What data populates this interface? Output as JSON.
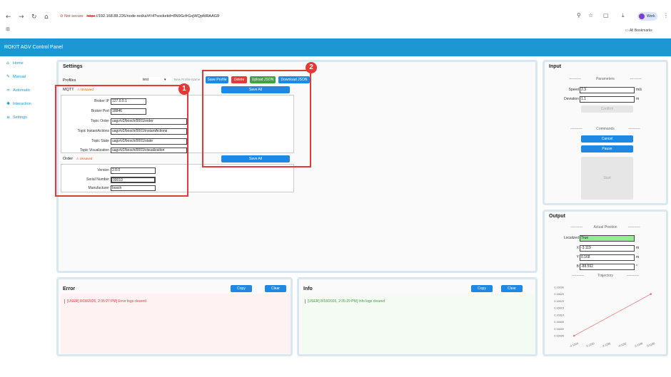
{
  "browser": {
    "not_secure": "Not secure",
    "url_proto": "https",
    "url_rest": "://192.168.88.226/node-red/ui/#!/4?socketid=8N9GcfrGxjWQpfdRAAG9",
    "profile": "Work",
    "all_bookmarks": "All Bookmarks"
  },
  "app": {
    "title": "ROKIT AGV Control Panel"
  },
  "sidebar": {
    "items": [
      {
        "label": "Home",
        "icon": "home-icon"
      },
      {
        "label": "Manual",
        "icon": "wrench-icon"
      },
      {
        "label": "Automatic",
        "icon": "infinity-icon"
      },
      {
        "label": "Interaction",
        "icon": "puzzle-icon"
      },
      {
        "label": "Settings",
        "icon": "sliders-icon"
      }
    ]
  },
  "settings": {
    "title": "Settings",
    "profiles_label": "Profiles",
    "profile_selected": "test",
    "new_profile_placeholder": "New Profile Name",
    "save_profile": "Save Profile",
    "delete": "Delete",
    "upload_json": "Upload JSON",
    "download_json": "Download JSON",
    "save_all": "Save All",
    "unsaved": "Unsaved",
    "mqtt": {
      "legend": "MQTT",
      "fields": [
        {
          "label": "Broker IP",
          "value": "127.0.0.1"
        },
        {
          "label": "Broker Port",
          "value": "18846"
        },
        {
          "label": "Topic Order",
          "value": "uagv/v2/bosch/0001/order"
        },
        {
          "label": "Topic InstantActions",
          "value": "uagv/v2/bosch/0001/instantActions"
        },
        {
          "label": "Topic State",
          "value": "uagv/v2/bosch/0001/state"
        },
        {
          "label": "Topic Visualization",
          "value": "uagv/v2/bosch/0001/visualization"
        }
      ]
    },
    "order": {
      "legend": "Order",
      "fields": [
        {
          "label": "Version",
          "value": "2.0.0"
        },
        {
          "label": "Serial Number",
          "value": "00010"
        },
        {
          "label": "Manufacturer",
          "value": "bosch"
        }
      ]
    }
  },
  "annotations": {
    "one": "1",
    "two": "2"
  },
  "input": {
    "title": "Input",
    "parameters_label": "Parameters",
    "speed_label": "Speed",
    "speed_value": "2.3",
    "speed_unit": "m/s",
    "deviation_label": "Deviation",
    "deviation_value": "1.1",
    "deviation_unit": "m",
    "confirm": "Confirm",
    "commands_label": "Commands",
    "cancel": "Cancel",
    "pause": "Pause",
    "start": "Start"
  },
  "output": {
    "title": "Output",
    "actual_position_label": "Actual Position",
    "localized_label": "Localized",
    "localized_value": "True",
    "x_label": "X",
    "x_value": "-3.119",
    "x_unit": "m",
    "y_label": "Y",
    "y_value": "0.168",
    "y_unit": "m",
    "b_label": "B",
    "b_value": "-88.592",
    "b_unit": "°",
    "trajectory_label": "Trajectory",
    "dashes": "----------"
  },
  "error": {
    "title": "Error",
    "copy": "Copy",
    "clear": "Clear",
    "log": "[USER] 8/18/2026, 2:35:27 PM] Error logs cleared"
  },
  "info": {
    "title": "Info",
    "copy": "Copy",
    "clear": "Clear",
    "log": "[USER] 8/18/2026, 2:35:29 PM] Info logs cleared"
  },
  "chart_data": {
    "type": "line",
    "x": [
      -3.1204,
      -3.1185
    ],
    "y": [
      0.16595,
      0.16625
    ],
    "yticks": [
      "0.16630",
      "0.16625",
      "0.16620",
      "0.16615",
      "0.16610",
      "0.16605",
      "0.16600",
      "0.16595"
    ],
    "xticks": [
      "-3.1204",
      "-3.1200",
      "-3.1196",
      "-3.1192",
      "-3.1188",
      "-3.1185"
    ],
    "line_color": "#f08080"
  }
}
